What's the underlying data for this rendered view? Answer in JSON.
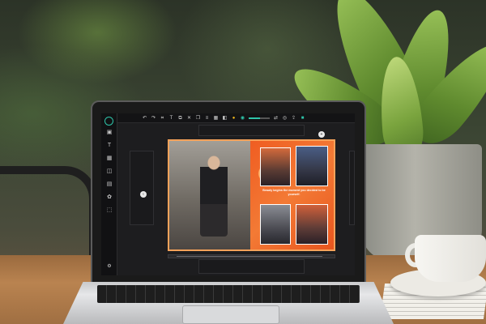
{
  "scene": {
    "description_icons": [
      "laptop",
      "plant",
      "coffee-cup",
      "chair"
    ]
  },
  "app": {
    "left_toolbar": [
      {
        "icon": "image-icon",
        "label": ""
      },
      {
        "icon": "text-icon",
        "label": ""
      },
      {
        "icon": "grid-icon",
        "label": ""
      },
      {
        "icon": "shapes-icon",
        "label": ""
      },
      {
        "icon": "background-icon",
        "label": ""
      },
      {
        "icon": "elements-icon",
        "label": ""
      },
      {
        "icon": "frames-icon",
        "label": ""
      }
    ],
    "bottom_left": {
      "icon": "settings-icon",
      "label": ""
    },
    "top_toolbar": {
      "icons": [
        "undo-icon",
        "redo-icon",
        "crop-icon",
        "text-icon",
        "copy-icon",
        "close-icon",
        "duplicate-icon",
        "align-icon",
        "grid-icon",
        "layers-icon",
        "flip-icon",
        "lock-icon"
      ],
      "zoom_level": 0.55
    },
    "page": {
      "quote": "Beauty begins the moment you decided to be yourself."
    },
    "nav": {
      "prev": "‹",
      "next": "›",
      "add": "+"
    }
  },
  "colors": {
    "accent": "#2ec4a9",
    "highlight": "#f1b81d",
    "page_bg": "#f06a2a"
  }
}
